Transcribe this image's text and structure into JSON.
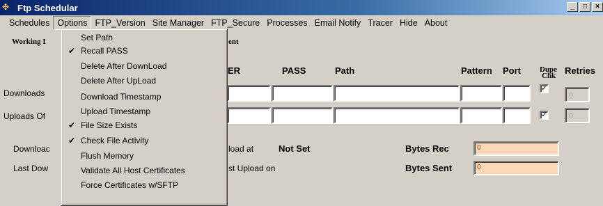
{
  "window": {
    "title": "Ftp Schedular",
    "controls": [
      "_",
      "□",
      "×"
    ]
  },
  "menubar": {
    "items": [
      "Schedules",
      "Options",
      "FTP_Version",
      "Site Manager",
      "FTP_Secure",
      "Processes",
      "Email Notify",
      "Tracer",
      "Hide",
      "About"
    ]
  },
  "options_menu": {
    "items": [
      {
        "label": "Set Path",
        "checked": false
      },
      {
        "label": "Recall PASS",
        "checked": true
      },
      {
        "label": "Delete After DownLoad",
        "checked": false
      },
      {
        "label": "Delete After UpLoad",
        "checked": false
      },
      {
        "label": "Download Timestamp",
        "checked": false
      },
      {
        "label": "Upload Timestamp",
        "checked": false
      },
      {
        "label": "File Size Exists",
        "checked": true
      },
      {
        "label": "Check File Activity",
        "checked": true
      },
      {
        "label": "Flush Memory",
        "checked": false
      },
      {
        "label": "Validate All Host Certificates",
        "checked": false
      },
      {
        "label": "Force Certificates w/SFTP",
        "checked": false
      }
    ]
  },
  "main": {
    "working_label_partial": "Working I",
    "working_label_suffix": "ent",
    "headers": {
      "user_partial": "ER",
      "pass": "PASS",
      "path": "Path",
      "pattern": "Pattern",
      "port": "Port",
      "dupe_line1": "Dupe",
      "dupe_line2": "Chk",
      "retries": "Retries"
    },
    "rows": [
      {
        "label": "Downloads",
        "dupe_checked": true,
        "retries": "0"
      },
      {
        "label": "Uploads Of",
        "dupe_checked": true,
        "retries": "0"
      }
    ],
    "status": {
      "download_label_partial": "Downloac",
      "upload_at_partial": "load at",
      "upload_at_value": "Not Set",
      "last_down_partial": "Last Dow",
      "last_upload_partial": "st Upload on",
      "bytes_rec_label": "Bytes Rec",
      "bytes_rec_value": "0",
      "bytes_sent_label": "Bytes Sent",
      "bytes_sent_value": "0"
    }
  },
  "colors": {
    "titlebar_start": "#0a246a",
    "titlebar_end": "#a6caf0",
    "face": "#d4d0c8",
    "peach_field": "#fcd8b8"
  }
}
